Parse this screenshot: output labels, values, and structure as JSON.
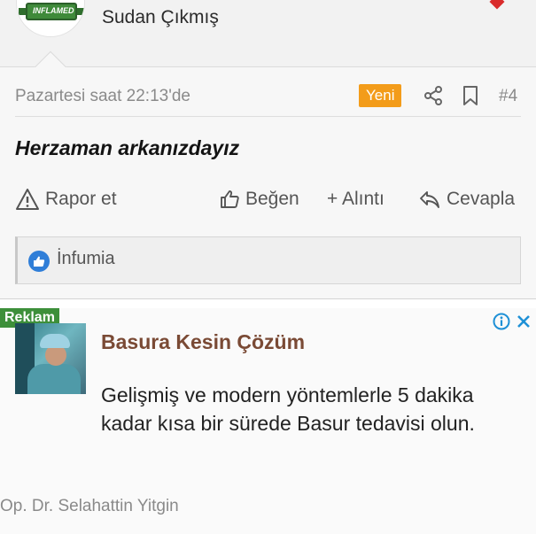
{
  "user": {
    "name": "Sudan Çıkmış",
    "avatar_badge_text": "INFLAMED"
  },
  "post": {
    "timestamp": "Pazartesi saat 22:13'de",
    "new_badge": "Yeni",
    "number": "#4",
    "text": "Herzaman arkanızdayız",
    "icons": {
      "share": "share-icon",
      "bookmark": "bookmark-icon"
    }
  },
  "actions": {
    "report": "Rapor et",
    "like": "Beğen",
    "quote": "+ Alıntı",
    "reply": "Cevapla"
  },
  "reactions": {
    "users": "İnfumia"
  },
  "ad": {
    "label": "Reklam",
    "title": "Basura Kesin Çözüm",
    "description": "Gelişmiş ve modern yöntemlerle 5 dakika kadar kısa bir sürede Basur tedavisi olun.",
    "source": "Op. Dr. Selahattin Yitgin"
  },
  "colors": {
    "accent_orange": "#f39c1a",
    "ad_label_green": "#3d8f3a",
    "like_blue": "#2f7ed8",
    "ad_title_brown": "#7a4a35",
    "corner_red": "#d92b2b"
  }
}
